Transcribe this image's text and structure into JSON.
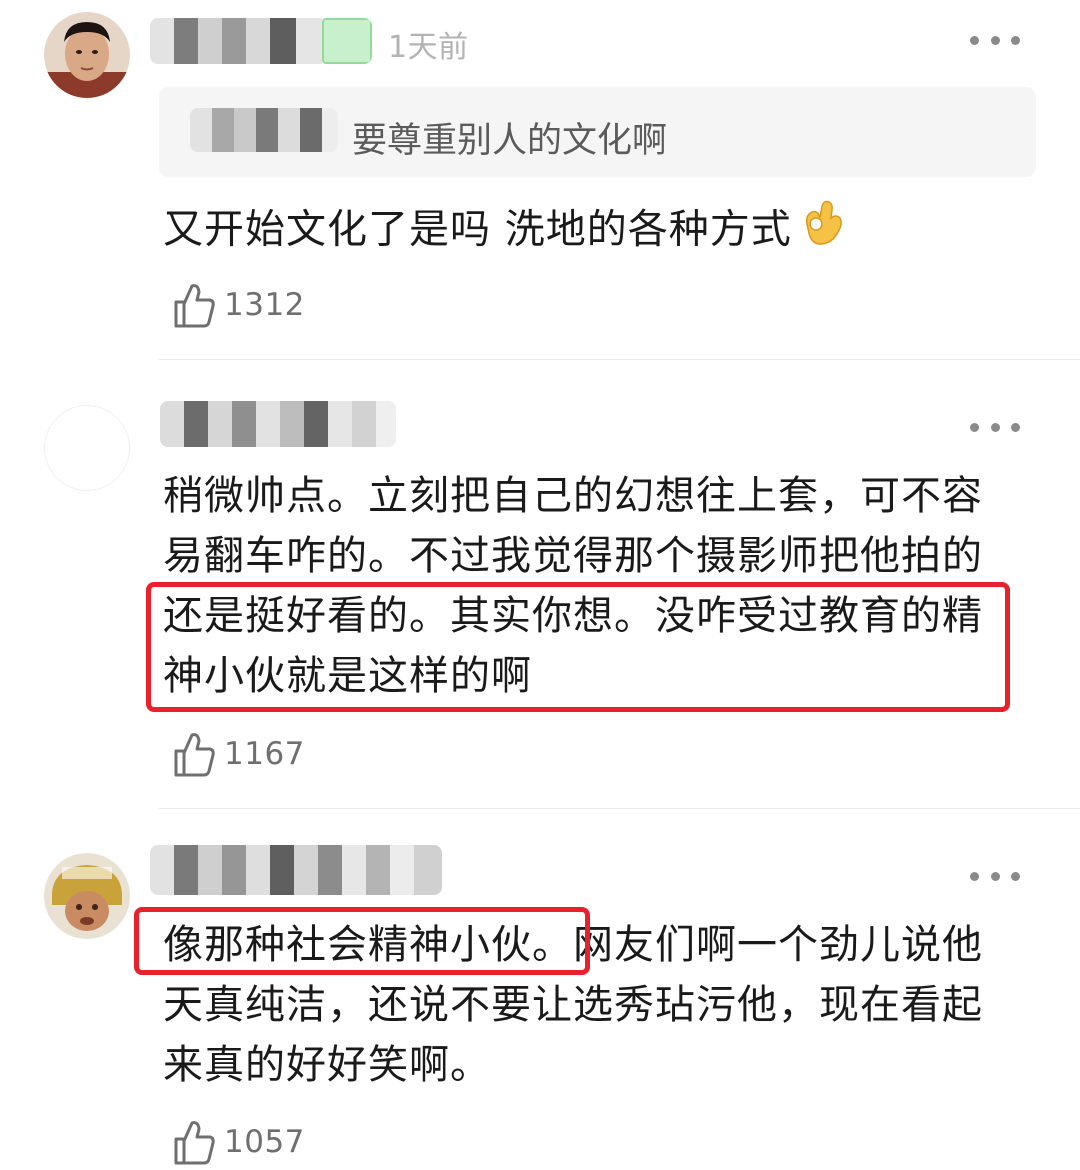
{
  "comments": [
    {
      "timestamp": "1天前",
      "quote": "要尊重别人的文化啊",
      "text": "又开始文化了是吗 洗地的各种方式",
      "emoji": "ok-hand-emoji",
      "likes": "1312"
    },
    {
      "text": "稍微帅点。立刻把自己的幻想往上套，可不容易翻车咋的。不过我觉得那个摄影师把他拍的还是挺好看的。其实你想。没咋受过教育的精神小伙就是这样的啊",
      "likes": "1167"
    },
    {
      "text": "像那种社会精神小伙。网友们啊一个劲儿说他天真纯洁，还说不要让选秀玷污他，现在看起来真的好好笑啊。",
      "likes": "1057"
    }
  ],
  "colors": {
    "highlight_box": "#e8212d",
    "muted_text": "#b3b3b3",
    "like_count": "#6f6f6f",
    "quote_bg": "#f5f5f5"
  },
  "icons": {
    "like": "thumbs-up-outline-icon",
    "more": "more-dots-icon"
  }
}
